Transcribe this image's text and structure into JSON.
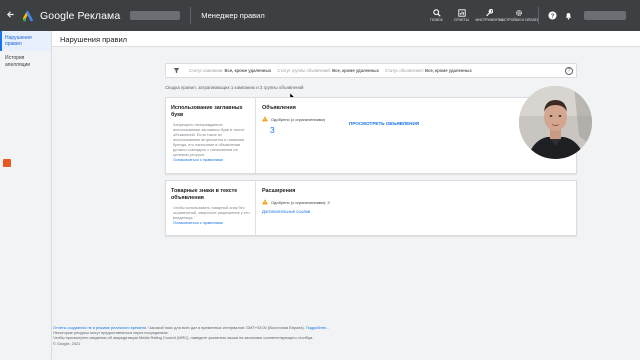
{
  "topbar": {
    "back_icon": "back-arrow-icon",
    "brand": "Google Реклама",
    "section_title": "Менеджер правил",
    "tools": [
      {
        "icon": "search-icon",
        "label": "поиск"
      },
      {
        "icon": "reports-icon",
        "label": "отчеты"
      },
      {
        "icon": "wrench-icon",
        "label": "инструменты"
      },
      {
        "icon": "gear-icon",
        "label": "настройки и оплата"
      }
    ],
    "help_icon": "help-icon",
    "bell_icon": "bell-icon"
  },
  "sidebar": {
    "items": [
      {
        "label": "Нарушения правил",
        "active": true
      },
      {
        "label": "История апелляции",
        "active": false
      }
    ]
  },
  "page": {
    "title": "Нарушения правил"
  },
  "filter_bar": {
    "parts": [
      {
        "label": "Статус кампании:",
        "value": "Все, кроме удаленных"
      },
      {
        "label": "Статус группы объявлений:",
        "value": "Все, кроме удаленных"
      },
      {
        "label": "Статус объявления:",
        "value": "Все, кроме удаленных"
      }
    ]
  },
  "summary": "Сводка правил, затрагивающих 1 кампанию и 3 группы объявлений",
  "cards": [
    {
      "left_title": "Использование заглавных букв",
      "left_desc": "Запрещено неоправданное использование заглавных букв в тексте объявлений. Если такое их использование встречается в названии бренда, его написание в объявлении должно совпадать с написанием на целевом ресурсе.",
      "left_link": "Ознакомиться с правилами",
      "right_title": "Объявления",
      "status": "Одобрено (с ограничениями)",
      "count": "3",
      "view_link": "ПРОСМОТРЕТЬ ОБЪЯВЛЕНИЯ"
    },
    {
      "left_title": "Товарные знаки в тексте объявления",
      "left_desc": "Чтобы использовать товарный знак без ограничений, запросите разрешение у его владельца.",
      "left_link": "Ознакомиться с правилами",
      "right_title": "Расширения",
      "status": "Одобрено (с ограничениями): 3",
      "extra_link": "Дополнительные ссылки"
    }
  ],
  "footer": {
    "line1_link": "Отчеты создаются не в режиме реального времени",
    "line1_text": ". Часовой пояс для всех дат и временных интервалов: GMT+03:00 (Восточная Европа).",
    "line1_more": "Подробнее...",
    "line2": "Некоторые ресурсы могут предоставляться через посредников.",
    "line3": "Чтобы просмотреть сведения об аккредитации Media Rating Council (MRC), наведите указатель мыши на заголовки соответствующего столбца.",
    "copyright": "© Google, 2021"
  },
  "colors": {
    "topbar": "#3c4043",
    "accent": "#1a73e8",
    "warning": "#f29900",
    "record_marker": "#e8571e"
  }
}
